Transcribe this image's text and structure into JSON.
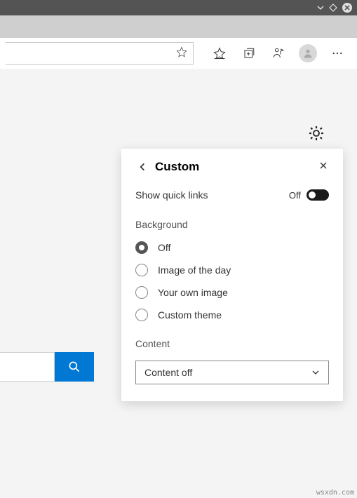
{
  "titlebar": {
    "icons": [
      "chevron-down",
      "diamond",
      "close"
    ]
  },
  "popover": {
    "title": "Custom",
    "quick_links": {
      "label": "Show quick links",
      "state": "Off"
    },
    "background": {
      "label": "Background",
      "options": [
        "Off",
        "Image of the day",
        "Your own image",
        "Custom theme"
      ],
      "selected": "Off"
    },
    "content": {
      "label": "Content",
      "value": "Content off"
    }
  },
  "watermark": "wsxdn.com"
}
